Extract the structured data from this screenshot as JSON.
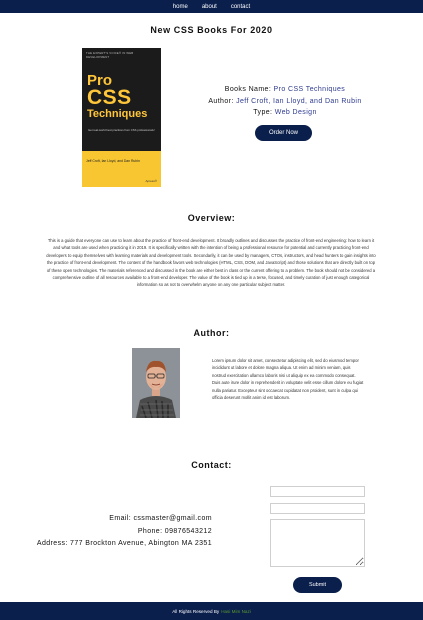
{
  "nav": {
    "items": [
      "home",
      "about",
      "contact"
    ]
  },
  "page_title": "New CSS Books For 2020",
  "book": {
    "cover": {
      "top_text": "THE EXPERT'S VOICE® IN WEB DEVELOPMENT",
      "title_line1": "Pro",
      "title_line2": "CSS",
      "title_line3": "Techniques",
      "subtitle": "Get real-world best practices from CSS professionals!",
      "authors": "Jeff Croft, Ian Lloyd, and Dan Rubin",
      "publisher": "Apress®"
    },
    "name_label": "Books Name:",
    "name_value": "Pro CSS Techniques",
    "author_label": "Author:",
    "author_value": "Jeff Croft, Ian Lloyd, and Dan Rubin",
    "type_label": "Type:",
    "type_value": "Web Design",
    "order_label": "Order Now"
  },
  "overview": {
    "heading": "Overview:",
    "text": "This is a guide that everyone can use to learn about the practice of front-end development. It broadly outlines and discusses the practice of front-end engineering: how to learn it and what tools are used when practicing it in 2019. It is specifically written with the intention of being a professional resource for potential and currently practicing front-end developers to equip themselves with learning materials and development tools. Secondarily, it can be used by managers, CTOs, instructors, and head hunters to gain insights into the practice of front-end development. The content of the handbook favors web technologies (HTML, CSS, DOM, and JavaScript) and those solutions that are directly built on top of these open technologies. The materials referenced and discussed in the book are either best in class or the current offering to a problem. The book should not be considered a comprehensive outline of all resources available to a front-end developer. The value of the book is tied up in a terse, focused, and timely curation of just enough categorical information so as not to overwhelm anyone on any one particular subject matter."
  },
  "author": {
    "heading": "Author:",
    "bio": "Lorem ipsum dolor sit amet, consectetur adipiscing elit, sed do eiusmod tempor incididunt ut labore et dolore magna aliqua. Ut enim ad minim veniam, quis nostrud exercitation ullamco laboris nisi ut aliquip ex ea commodo consequat. Duis aute irure dolor in reprehenderit in voluptate velit esse cillum dolore eu fugiat nulla pariatur. Excepteur sint occaecat cupidatat non proident, sunt in culpa qui officia deserunt mollit anim id est laborum."
  },
  "contact": {
    "heading": "Contact:",
    "email": "Email:  cssmaster@gmail.com",
    "phone": "Phone:  09876543212",
    "address": "Address:  777 Brockton Avenue, Abington MA 2351",
    "submit_label": "Submit"
  },
  "footer": {
    "text": "All Rights Reserved By",
    "link": "Hasi Mim Nazi"
  },
  "colors": {
    "primary": "#0b1f4d",
    "accent_text": "#2f3c8f",
    "cover_yellow": "#f7c631",
    "footer_link": "#5a9a2e"
  }
}
